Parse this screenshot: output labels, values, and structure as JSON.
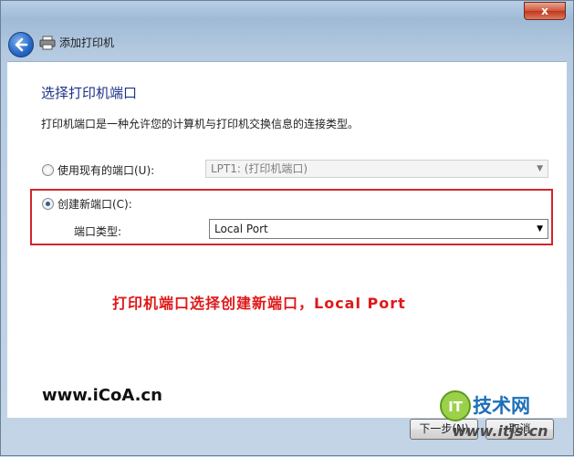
{
  "window": {
    "close_label": "x"
  },
  "header": {
    "title": "添加打印机"
  },
  "page": {
    "heading": "选择打印机端口",
    "description": "打印机端口是一种允许您的计算机与打印机交换信息的连接类型。"
  },
  "existing_port": {
    "label": "使用现有的端口(U):",
    "selected": "LPT1: (打印机端口)",
    "checked": false
  },
  "new_port": {
    "label": "创建新端口(C):",
    "checked": true,
    "type_label": "端口类型:",
    "type_selected": "Local Port"
  },
  "annotation": "打印机端口选择创建新端口，Local Port",
  "watermark_left": "www.iCoA.cn",
  "buttons": {
    "next": "下一步(N)",
    "cancel": "取消"
  },
  "logo": {
    "badge": "IT",
    "text": "技术网",
    "url": "www.itjs.cn"
  },
  "colors": {
    "heading": "#1e3287",
    "annotation": "#e01818",
    "highlight_border": "#d4252a"
  }
}
